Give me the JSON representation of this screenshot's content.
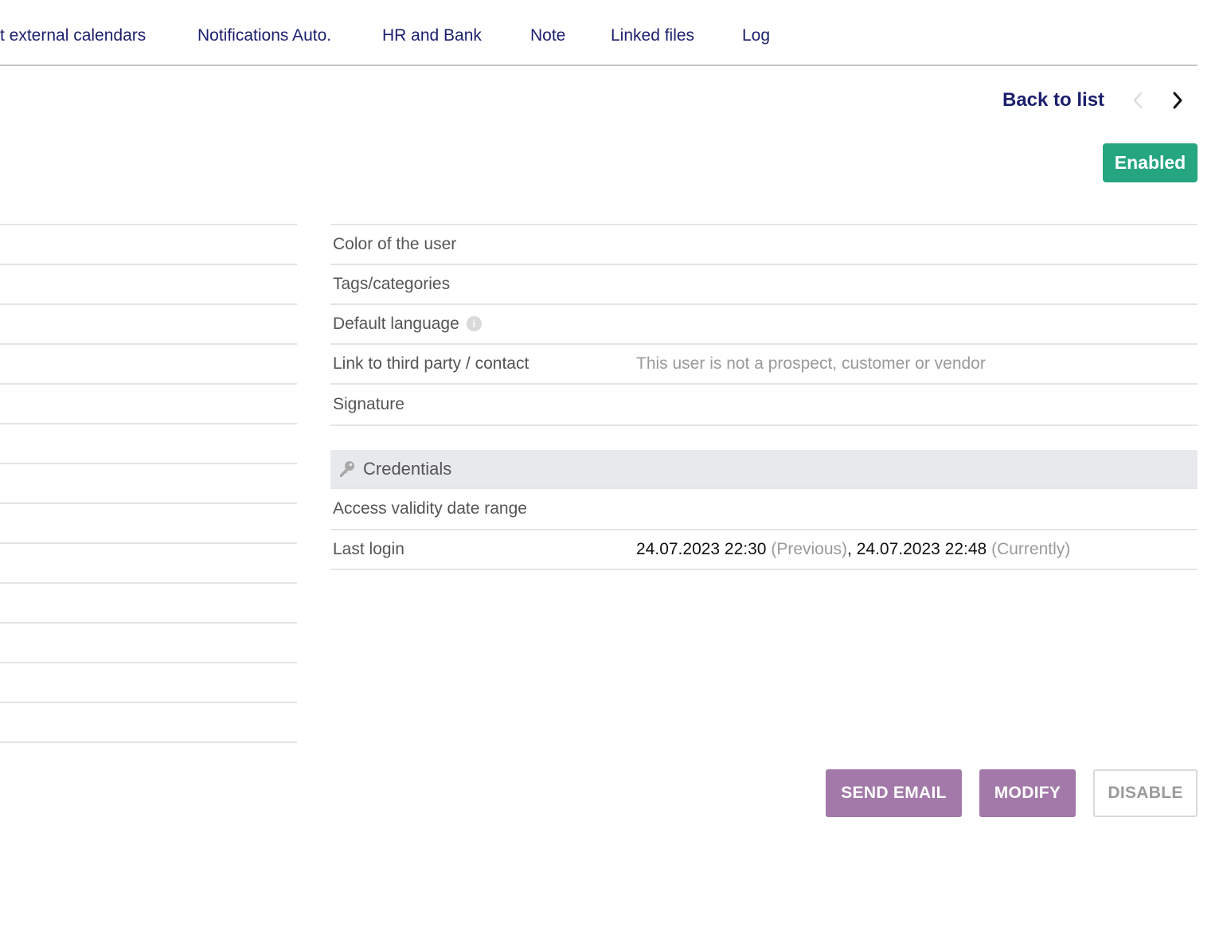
{
  "tabs": [
    {
      "label": "t external calendars"
    },
    {
      "label": "Notifications Auto."
    },
    {
      "label": "HR and Bank"
    },
    {
      "label": "Note"
    },
    {
      "label": "Linked files"
    },
    {
      "label": "Log"
    }
  ],
  "nav": {
    "back_label": "Back to list",
    "prev_icon": "chevron-left-icon",
    "next_icon": "chevron-right-icon"
  },
  "status": {
    "label": "Enabled",
    "color": "#25a580"
  },
  "fields": {
    "color_label": "Color of the user",
    "tags_label": "Tags/categories",
    "language_label": "Default language",
    "language_info": "i",
    "third_party_label": "Link to third party / contact",
    "third_party_value": "This user is not a prospect, customer or vendor",
    "signature_label": "Signature"
  },
  "credentials": {
    "header": "Credentials",
    "header_icon": "key-icon",
    "access_label": "Access validity date range",
    "last_login_label": "Last login",
    "last_login_previous": "24.07.2023 22:30",
    "last_login_previous_tag": "(Previous)",
    "separator": ",",
    "last_login_current": "24.07.2023 22:48",
    "last_login_current_tag": "(Currently)"
  },
  "actions": {
    "send_email": "SEND EMAIL",
    "modify": "MODIFY",
    "disable": "DISABLE",
    "primary_color": "#a279a8"
  }
}
